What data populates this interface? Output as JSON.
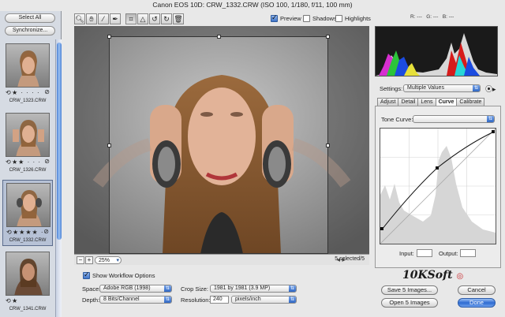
{
  "window": {
    "title": "Canon EOS 10D:  CRW_1332.CRW  (ISO 100, 1/180, f/11, 100 mm)"
  },
  "filmstrip": {
    "select_all": "Select All",
    "synchronize": "Synchronize...",
    "thumbnails": [
      {
        "file": "CRW_1323.CRW",
        "stars": "★ · · · ·",
        "selected": false
      },
      {
        "file": "CRW_1326.CRW",
        "stars": "★★ · · ·",
        "selected": false
      },
      {
        "file": "CRW_1332.CRW",
        "stars": "★★★★ ·",
        "selected": true
      },
      {
        "file": "CRW_1341.CRW",
        "stars": "★",
        "selected": false
      }
    ]
  },
  "toolbar": {
    "tools": [
      "zoom-icon",
      "hand-icon",
      "white-balance-icon",
      "color-sampler-icon",
      "crop-icon",
      "straighten-icon",
      "rotate-left-icon",
      "rotate-right-icon",
      "trash-icon"
    ],
    "preview_label": "Preview",
    "preview_checked": true,
    "shadows_label": "Shadows",
    "shadows_checked": false,
    "highlights_label": "Highlights",
    "highlights_checked": false
  },
  "readout": {
    "r": "R:  ---",
    "g": "G:  ---",
    "b": "B:  ---"
  },
  "preview_bar": {
    "zoom": "25%",
    "selection": "5 selected/5"
  },
  "workflow": {
    "show_label": "Show Workflow Options",
    "show_checked": true,
    "space_label": "Space:",
    "space_value": "Adobe RGB (1998)",
    "depth_label": "Depth:",
    "depth_value": "8 Bits/Channel",
    "crop_label": "Crop Size:",
    "crop_value": "1981 by 1981  (3.9 MP)",
    "resolution_label": "Resolution:",
    "resolution_value": "240",
    "resolution_unit": "pixels/inch"
  },
  "settings": {
    "label": "Settings:",
    "value": "Multiple Values",
    "tabs": [
      "Adjust",
      "Detail",
      "Lens",
      "Curve",
      "Calibrate"
    ],
    "active_tab": "Curve",
    "tone_curve_label": "Tone Curve:",
    "tone_curve_value": "",
    "input_label": "Input:",
    "output_label": "Output:"
  },
  "buttons": {
    "save": "Save 5 Images...",
    "cancel": "Cancel",
    "open": "Open 5 Images",
    "done": "Done"
  },
  "watermark": {
    "text": "10KSoft"
  },
  "colors": {
    "accent": "#2e6bd1",
    "panel": "#e8e8e8",
    "filmstrip": "#d6dbe3"
  }
}
